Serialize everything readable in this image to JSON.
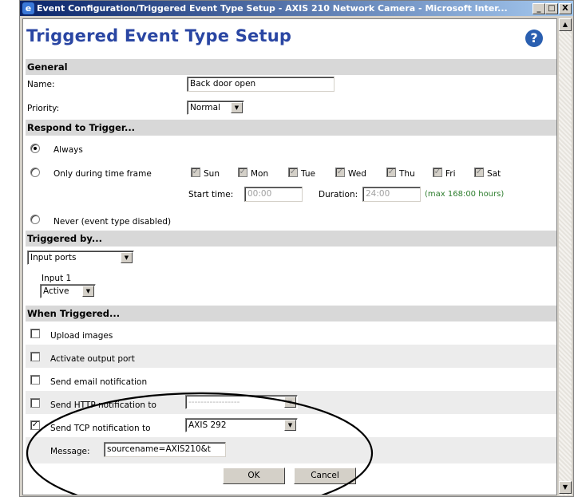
{
  "window": {
    "title": "Event Configuration/Triggered Event Type Setup - AXIS 210 Network Camera - Microsoft Inter...",
    "minimize": "_",
    "maximize": "□",
    "close": "X"
  },
  "page": {
    "title": "Triggered Event Type Setup",
    "help": "?"
  },
  "general": {
    "header": "General",
    "name_label": "Name:",
    "name_value": "Back door open",
    "priority_label": "Priority:",
    "priority_value": "Normal"
  },
  "respond": {
    "header": "Respond to Trigger...",
    "always": "Always",
    "only_during": "Only during time frame",
    "days": [
      "Sun",
      "Mon",
      "Tue",
      "Wed",
      "Thu",
      "Fri",
      "Sat"
    ],
    "start_label": "Start time:",
    "start_value": "00:00",
    "duration_label": "Duration:",
    "duration_value": "24:00",
    "max_note": "(max 168:00 hours)",
    "never": "Never (event type disabled)",
    "selected": "Always"
  },
  "triggered_by": {
    "header": "Triggered by...",
    "source_value": "Input ports",
    "input_label": "Input 1",
    "input_state": "Active"
  },
  "when_triggered": {
    "header": "When Triggered...",
    "upload": "Upload images",
    "output": "Activate output port",
    "email": "Send email notification",
    "http": "Send HTTP notification to",
    "tcp": "Send TCP notification to",
    "tcp_target": "AXIS 292",
    "http_target": "-----------------",
    "message_label": "Message:",
    "message_value": "sourcename=AXIS210&t",
    "tcp_checked": true
  },
  "buttons": {
    "ok": "OK",
    "cancel": "Cancel"
  },
  "colors": {
    "title": "#2a46a3",
    "section": "#d8d8d8",
    "titlebar": "#0a246a"
  }
}
